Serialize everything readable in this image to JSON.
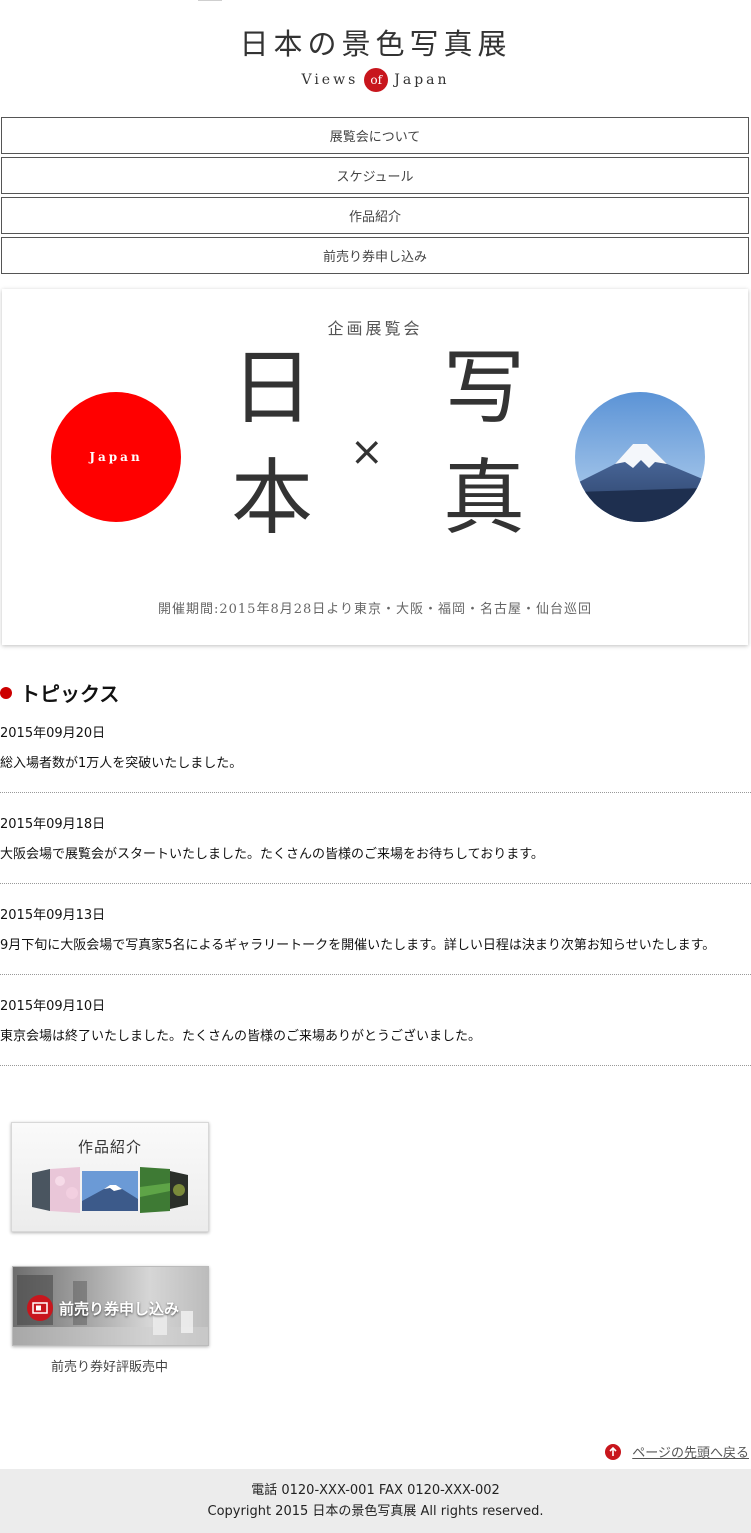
{
  "logo": {
    "title": "日本の景色写真展",
    "sub_left": "Views",
    "sub_of": "of",
    "sub_right": "Japan"
  },
  "nav": [
    {
      "label": "展覧会について"
    },
    {
      "label": "スケジュール"
    },
    {
      "label": "作品紹介"
    },
    {
      "label": "前売り券申し込み"
    }
  ],
  "hero": {
    "subtitle": "企画展覧会",
    "sun_text": "Japan",
    "kanji_left_top": "日",
    "kanji_left_bottom": "本",
    "times": "×",
    "kanji_right_top": "写",
    "kanji_right_bottom": "真",
    "period": "開催期間:2015年8月28日より東京・大阪・福岡・名古屋・仙台巡回",
    "sun_color": "#ff0000"
  },
  "topics": {
    "title": "トピックス",
    "items": [
      {
        "date": "2015年09月20日",
        "text": "総入場者数が1万人を突破いたしました。"
      },
      {
        "date": "2015年09月18日",
        "text": "大阪会場で展覧会がスタートいたしました。たくさんの皆様のご来場をお待ちしております。"
      },
      {
        "date": "2015年09月13日",
        "text": "9月下旬に大阪会場で写真家5名によるギャラリートークを開催いたします。詳しい日程は決まり次第お知らせいたします。"
      },
      {
        "date": "2015年09月10日",
        "text": "東京会場は終了いたしました。たくさんの皆様のご来場ありがとうございました。"
      }
    ]
  },
  "banners": {
    "works_label": "作品紹介",
    "ticket_label": "前売り券申し込み",
    "ticket_caption": "前売り券好評販売中"
  },
  "pagetop": {
    "label": "ページの先頭へ戻る"
  },
  "footer": {
    "contact": "電話 0120-XXX-001 FAX 0120-XXX-002",
    "copyright": "Copyright 2015 日本の景色写真展 All rights reserved."
  },
  "colors": {
    "accent": "#c8161d",
    "footer_bg": "#ececec"
  }
}
